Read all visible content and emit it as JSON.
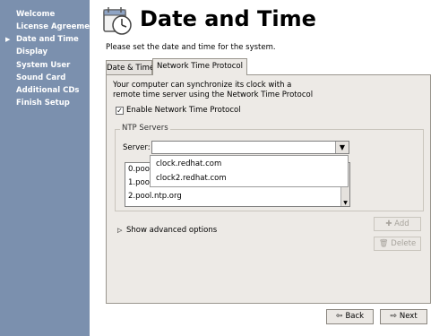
{
  "sidebar": {
    "items": [
      {
        "label": "Welcome"
      },
      {
        "label": "License Agreement"
      },
      {
        "label": "Date and Time"
      },
      {
        "label": "Display"
      },
      {
        "label": "System User"
      },
      {
        "label": "Sound Card"
      },
      {
        "label": "Additional CDs"
      },
      {
        "label": "Finish Setup"
      }
    ],
    "current_index": 2
  },
  "header": {
    "title": "Date and Time",
    "icon": "calendar-clock-icon"
  },
  "description": "Please set the date and time for the system.",
  "tabs": [
    {
      "label": "Date & Time"
    },
    {
      "label": "Network Time Protocol"
    }
  ],
  "ntp": {
    "info_line1": "Your computer can synchronize its clock with a",
    "info_line2": "remote time server using the Network Time Protocol",
    "enable_label": "Enable Network Time Protocol",
    "enable_checked": true,
    "servers_legend": "NTP Servers",
    "server_label": "Server:",
    "server_value": "",
    "servers": [
      "0.pool.ntp.org",
      "1.pool.ntp.org",
      "2.pool.ntp.org"
    ],
    "dropdown_options": [
      "clock.redhat.com",
      "clock2.redhat.com"
    ],
    "add_label": "Add",
    "delete_label": "Delete",
    "advanced_label": "Show advanced options"
  },
  "nav": {
    "back_label": "Back",
    "next_label": "Next"
  },
  "colors": {
    "sidebar_bg": "#7b90ae",
    "panel_bg": "#edeae6"
  }
}
